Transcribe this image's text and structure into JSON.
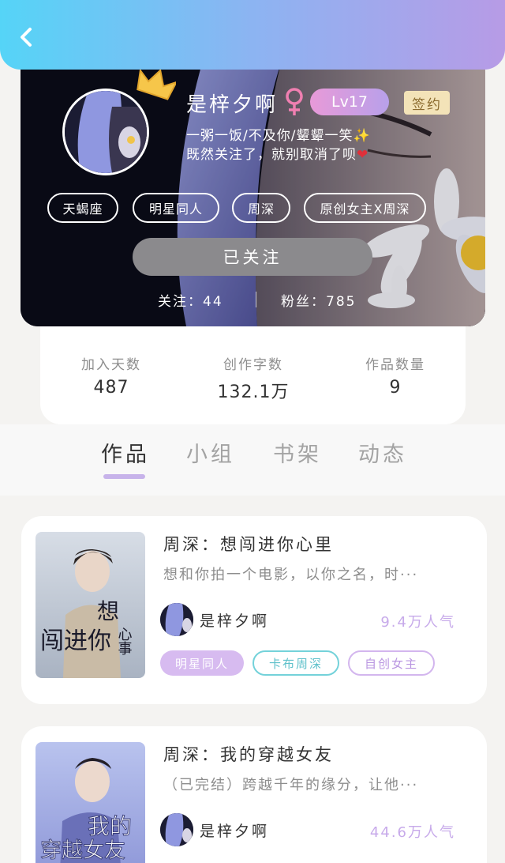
{
  "nav": {
    "back_icon": "chevron-left-icon"
  },
  "profile": {
    "nickname": "是梓夕啊",
    "gender_icon": "female-icon",
    "level": "Lv17",
    "sign_badge": "签约",
    "bio_line1": "一粥一饭/不及你/颦颦一笑",
    "bio_line1_emoji": "✨",
    "bio_line2": "既然关注了，就别取消了呗",
    "bio_line2_emoji": "❤",
    "tags": [
      "天蝎座",
      "明星同人",
      "周深",
      "原创女主X周深"
    ],
    "follow_button": "已关注",
    "following_label": "关注：",
    "following_count": "44",
    "fans_label": "粉丝：",
    "fans_count": "785"
  },
  "stats": [
    {
      "label": "加入天数",
      "value": "487"
    },
    {
      "label": "创作字数",
      "value": "132.1万"
    },
    {
      "label": "作品数量",
      "value": "9"
    }
  ],
  "tabs": [
    "作品",
    "小组",
    "书架",
    "动态"
  ],
  "active_tab": "作品",
  "books": [
    {
      "title": "周深：想闯进你心里",
      "description": "想和你拍一个电影，以你之名，时···",
      "author": "是梓夕啊",
      "popularity": "9.4万人气",
      "cover_text_top": "想",
      "cover_text_main": "闯进你",
      "cover_text_side": "心事",
      "tags": [
        "明星同人",
        "卡布周深",
        "自创女主"
      ]
    },
    {
      "title": "周深：我的穿越女友",
      "description": "（已完结）跨越千年的缘分，让他···",
      "author": "是梓夕啊",
      "popularity": "44.6万人气",
      "cover_text_top": "我的",
      "cover_text_main": "穿越女友",
      "tags": []
    }
  ],
  "colors": {
    "accent": "#c7b3ea",
    "topbar_start": "#55d4f7",
    "topbar_end": "#b79be6",
    "teal_tag": "#74d2da"
  }
}
